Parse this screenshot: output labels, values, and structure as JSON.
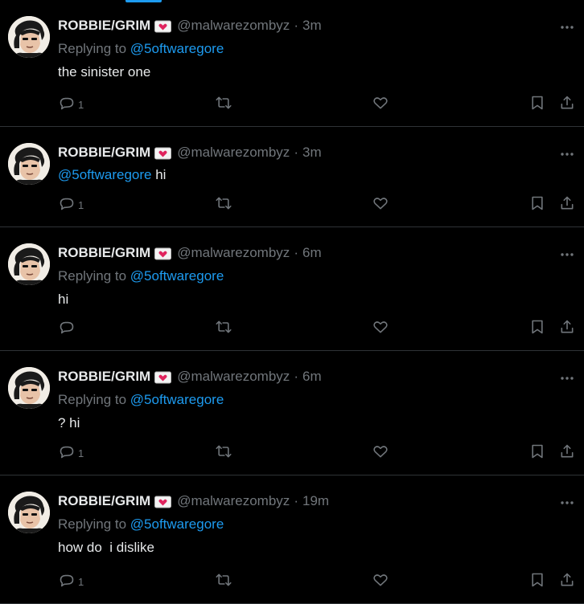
{
  "colors": {
    "background": "#000000",
    "text": "#e7e9ea",
    "muted": "#71767b",
    "accent": "#1d9bf0",
    "divider": "#2f3336"
  },
  "tweets": [
    {
      "name": "ROBBIE/GRIM",
      "handle": "@malwarezombyz",
      "sep": "·",
      "time": "3m",
      "reply_prefix": "Replying to",
      "reply_to": "@5oftwaregore",
      "mention": "",
      "text": "the sinister one",
      "reply_count": "1"
    },
    {
      "name": "ROBBIE/GRIM",
      "handle": "@malwarezombyz",
      "sep": "·",
      "time": "3m",
      "reply_prefix": "",
      "reply_to": "",
      "mention": "@5oftwaregore",
      "text": " hi",
      "reply_count": "1"
    },
    {
      "name": "ROBBIE/GRIM",
      "handle": "@malwarezombyz",
      "sep": "·",
      "time": "6m",
      "reply_prefix": "Replying to",
      "reply_to": "@5oftwaregore",
      "mention": "",
      "text": "hi",
      "reply_count": ""
    },
    {
      "name": "ROBBIE/GRIM",
      "handle": "@malwarezombyz",
      "sep": "·",
      "time": "6m",
      "reply_prefix": "Replying to",
      "reply_to": "@5oftwaregore",
      "mention": "",
      "text": "? hi",
      "reply_count": "1"
    },
    {
      "name": "ROBBIE/GRIM",
      "handle": "@malwarezombyz",
      "sep": "·",
      "time": "19m",
      "reply_prefix": "Replying to",
      "reply_to": "@5oftwaregore",
      "mention": "",
      "text": "how do  i dislike",
      "reply_count": "1"
    }
  ],
  "icons": {
    "reply": "reply-icon",
    "retweet": "retweet-icon",
    "like": "heart-icon",
    "bookmark": "bookmark-icon",
    "share": "share-icon",
    "more": "more-icon",
    "badge": "heart-letter-icon"
  }
}
